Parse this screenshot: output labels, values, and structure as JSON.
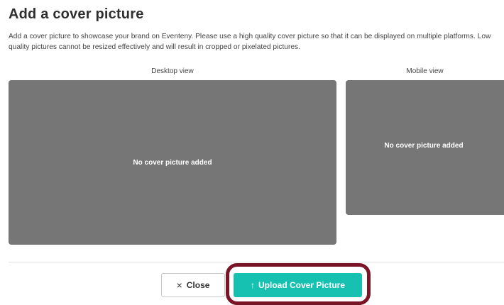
{
  "dialog": {
    "title": "Add a cover picture",
    "description": "Add a cover picture to showcase your brand on Eventeny. Please use a high quality cover picture so that it can be displayed on multiple platforms. Low quality pictures cannot be resized effectively and will result in cropped or pixelated pictures."
  },
  "previews": {
    "desktop": {
      "label": "Desktop view",
      "placeholder": "No cover picture added"
    },
    "mobile": {
      "label": "Mobile view",
      "placeholder": "No cover picture added"
    }
  },
  "actions": {
    "close_label": "Close",
    "close_icon": "×",
    "upload_label": "Upload Cover Picture",
    "upload_icon": "↑"
  },
  "colors": {
    "accent": "#17c1b1",
    "preview_bg": "#767676",
    "highlight": "#7a1427"
  }
}
